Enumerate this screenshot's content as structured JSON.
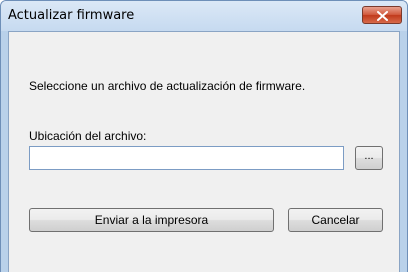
{
  "window": {
    "title": "Actualizar firmware"
  },
  "dialog": {
    "instruction": "Seleccione un archivo de actualización de firmware.",
    "location_label": "Ubicación del archivo:",
    "location_value": "",
    "browse_label": "...",
    "send_label": "Enviar a la impresora",
    "cancel_label": "Cancelar"
  },
  "icons": {
    "close": "close-icon"
  },
  "colors": {
    "close_button": "#c13a1c",
    "title_bar": "#dbe8f6",
    "client_bg": "#f0f0f0",
    "input_border": "#7c9cc4"
  }
}
